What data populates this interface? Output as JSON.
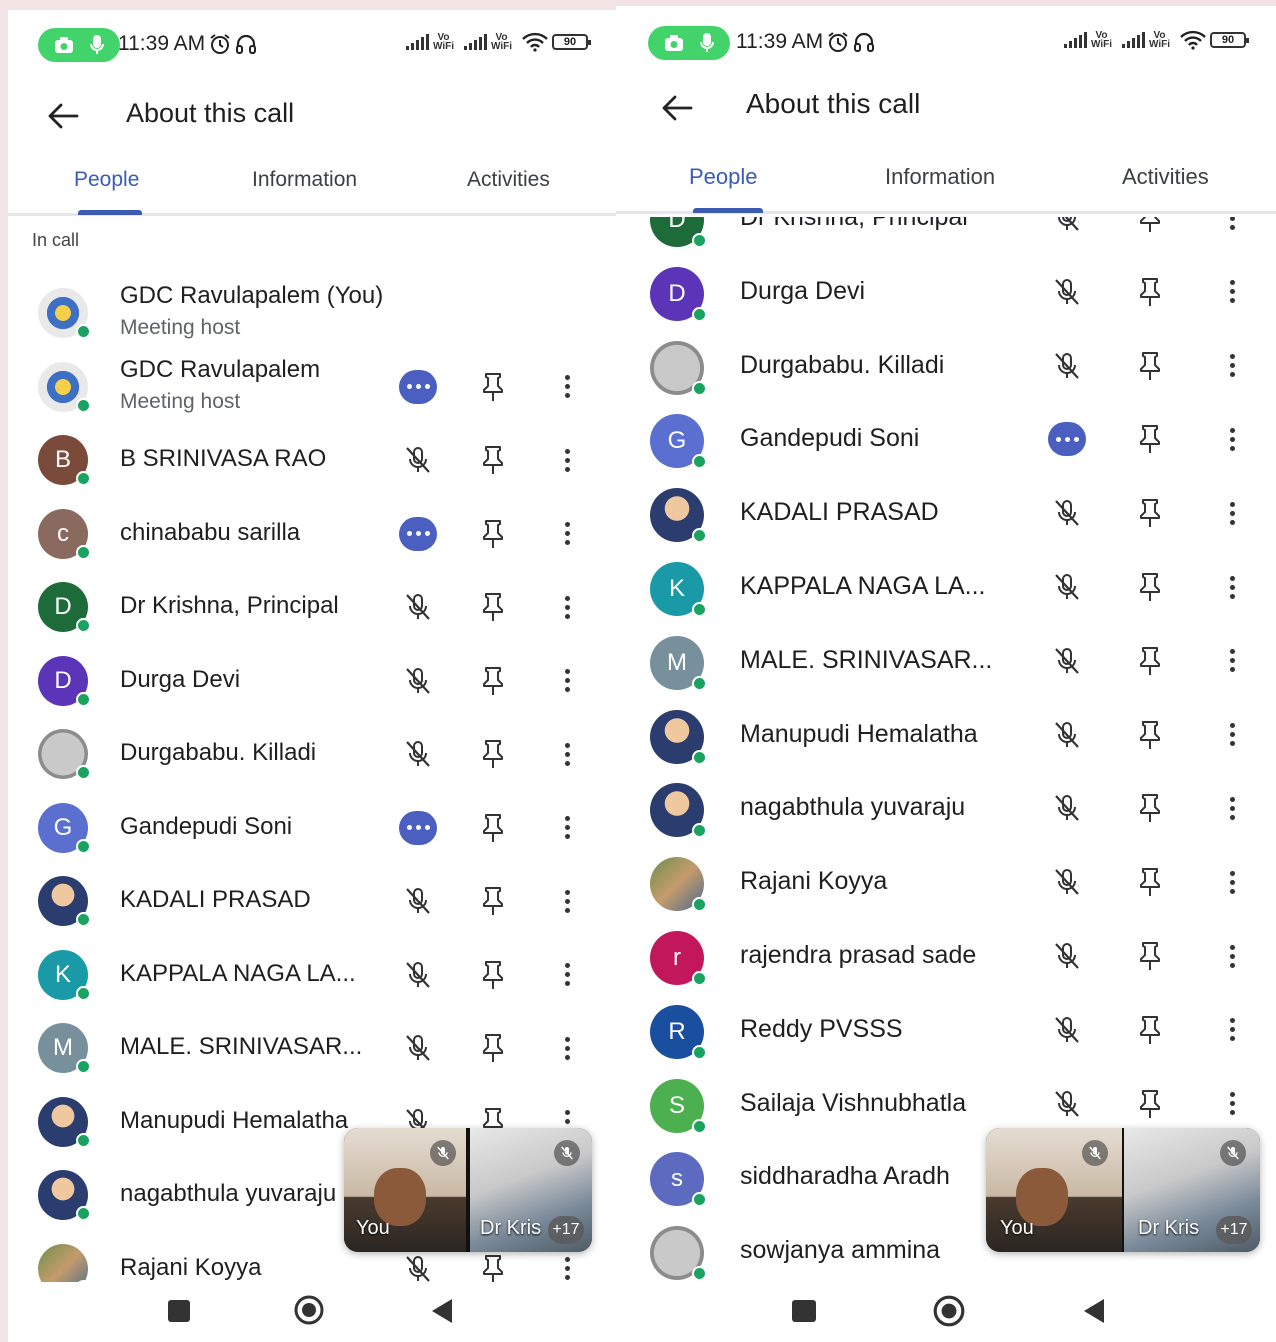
{
  "status": {
    "time": "11:39 AM",
    "battery": "90",
    "vo": "Vo",
    "wifi": "WiFi"
  },
  "appbar": {
    "title": "About this call"
  },
  "tabs": [
    {
      "label": "People"
    },
    {
      "label": "Information"
    },
    {
      "label": "Activities"
    }
  ],
  "section_label": "In call",
  "host_subtitle": "Meeting host",
  "left_participants": [
    {
      "name": "GDC Ravulapalem (You)",
      "avatar": "logo-avatar",
      "subtitle": "Meeting host",
      "status": "none"
    },
    {
      "name": "GDC Ravulapalem",
      "avatar": "logo-avatar",
      "subtitle": "Meeting host",
      "status": "more"
    },
    {
      "name": "B SRINIVASA RAO",
      "initial": "B",
      "color": "#7a4a3a",
      "status": "muted"
    },
    {
      "name": "chinababu sarilla",
      "initial": "c",
      "color": "#8a6a5e",
      "status": "more"
    },
    {
      "name": "Dr Krishna, Principal",
      "initial": "D",
      "color": "#1e6b3a",
      "status": "muted"
    },
    {
      "name": "Durga Devi",
      "initial": "D",
      "color": "#5b34b8",
      "status": "muted"
    },
    {
      "name": "Durgababu. Killadi",
      "avatar": "photo-avatar",
      "status": "muted"
    },
    {
      "name": "Gandepudi Soni",
      "initial": "G",
      "color": "#5a6fd0",
      "status": "more"
    },
    {
      "name": "KADALI PRASAD",
      "avatar": "photo-avatar",
      "status": "muted"
    },
    {
      "name": "KAPPALA NAGA LA...",
      "initial": "K",
      "color": "#1a9aa6",
      "status": "muted"
    },
    {
      "name": "MALE. SRINIVASAR...",
      "initial": "M",
      "color": "#78909c",
      "status": "muted"
    },
    {
      "name": "Manupudi Hemalatha",
      "avatar": "photo-avatar",
      "status": "muted"
    },
    {
      "name": "nagabthula yuvaraju",
      "avatar": "photo-avatar",
      "status": "muted"
    },
    {
      "name": "Rajani Koyya",
      "avatar": "photo-avatar",
      "status": "muted"
    }
  ],
  "right_participants": [
    {
      "name": "Dr Krishna, Principal",
      "initial": "D",
      "color": "#1e6b3a",
      "status": "muted"
    },
    {
      "name": "Durga Devi",
      "initial": "D",
      "color": "#5b34b8",
      "status": "muted"
    },
    {
      "name": "Durgababu. Killadi",
      "avatar": "photo-avatar",
      "status": "muted"
    },
    {
      "name": "Gandepudi Soni",
      "initial": "G",
      "color": "#5a6fd0",
      "status": "more"
    },
    {
      "name": "KADALI PRASAD",
      "avatar": "photo-avatar",
      "status": "muted"
    },
    {
      "name": "KAPPALA NAGA LA...",
      "initial": "K",
      "color": "#1a9aa6",
      "status": "muted"
    },
    {
      "name": "MALE. SRINIVASAR...",
      "initial": "M",
      "color": "#78909c",
      "status": "muted"
    },
    {
      "name": "Manupudi Hemalatha",
      "avatar": "photo-avatar",
      "status": "muted"
    },
    {
      "name": "nagabthula yuvaraju",
      "avatar": "photo-avatar",
      "status": "muted"
    },
    {
      "name": "Rajani Koyya",
      "avatar": "photo-avatar",
      "status": "muted"
    },
    {
      "name": "rajendra prasad sade",
      "initial": "r",
      "color": "#c2185b",
      "status": "muted"
    },
    {
      "name": "Reddy PVSSS",
      "initial": "R",
      "color": "#1a4fa0",
      "status": "muted"
    },
    {
      "name": "Sailaja Vishnubhatla",
      "initial": "S",
      "color": "#4caf50",
      "status": "muted"
    },
    {
      "name": "siddharadha Aradh",
      "initial": "s",
      "color": "#5c6bc0",
      "status": "none"
    },
    {
      "name": "sowjanya ammina",
      "avatar": "photo-avatar",
      "status": "none"
    }
  ],
  "pip": {
    "you_label": "You",
    "other_label": "Dr Kris",
    "extra_count": "+17"
  },
  "icons": {
    "back": "arrow-back-icon",
    "mic_off": "mic-off-icon",
    "pin": "pin-icon",
    "more": "more-vert-icon",
    "camera": "camera-icon",
    "mic": "mic-icon",
    "alarm": "alarm-icon",
    "headset": "headset-icon",
    "wifi": "wifi-icon"
  },
  "colors": {
    "accent": "#3b5bb5",
    "online": "#1aa260",
    "record_pill": "#43d36b",
    "more_bubble": "#4a5fbf"
  }
}
